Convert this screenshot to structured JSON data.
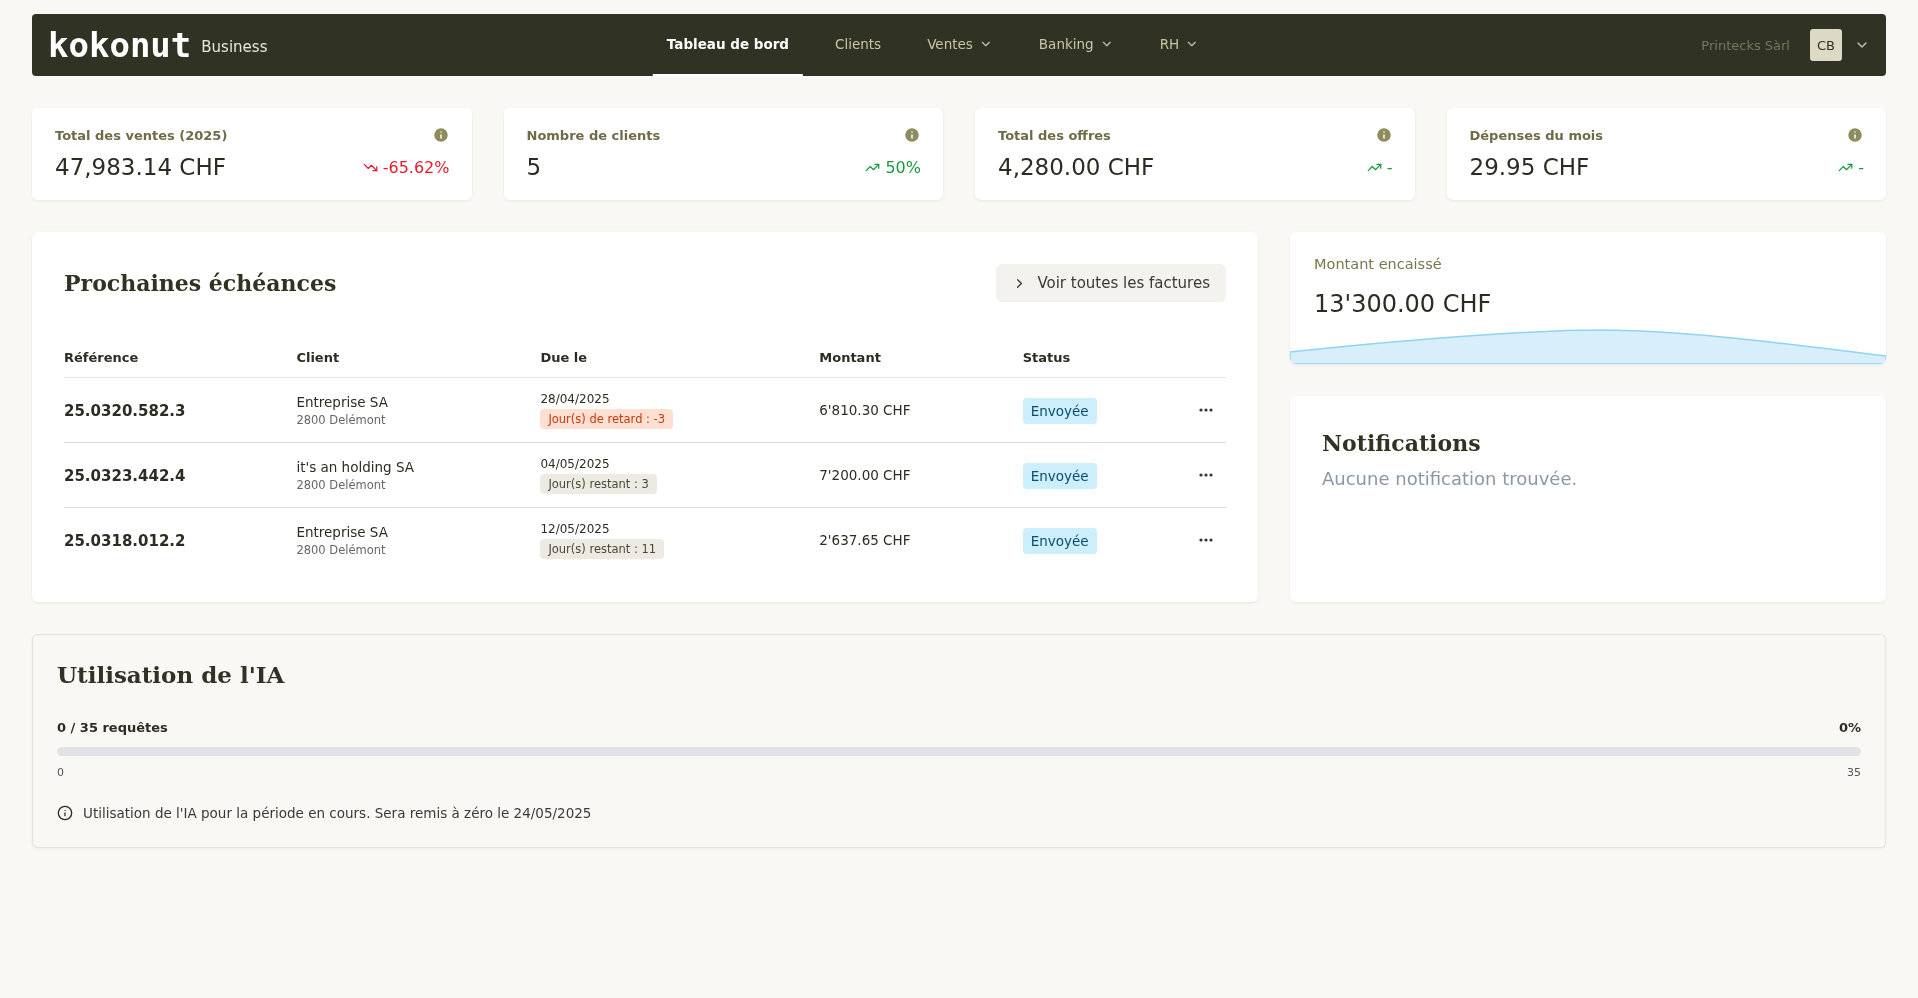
{
  "nav": {
    "logo": "kokonut",
    "logo_suffix": "Business",
    "items": [
      {
        "label": "Tableau de bord",
        "selected": true,
        "dropdown": false
      },
      {
        "label": "Clients",
        "selected": false,
        "dropdown": false
      },
      {
        "label": "Ventes",
        "selected": false,
        "dropdown": true
      },
      {
        "label": "Banking",
        "selected": false,
        "dropdown": true
      },
      {
        "label": "RH",
        "selected": false,
        "dropdown": true
      }
    ],
    "company": "Printecks Sàrl",
    "avatar": "CB"
  },
  "stats": [
    {
      "label": "Total des ventes (2025)",
      "value": "47,983.14 CHF",
      "trend": "-65.62%",
      "kind": "down"
    },
    {
      "label": "Nombre de clients",
      "value": "5",
      "trend": "50%",
      "kind": "up"
    },
    {
      "label": "Total des offres",
      "value": "4,280.00 CHF",
      "trend": "-",
      "kind": "up"
    },
    {
      "label": "Dépenses du mois",
      "value": "29.95 CHF",
      "trend": "-",
      "kind": "up"
    }
  ],
  "deadlines": {
    "title": "Prochaines échéances",
    "button": "Voir toutes les factures",
    "columns": [
      "Référence",
      "Client",
      "Due le",
      "Montant",
      "Status"
    ],
    "rows": [
      {
        "reference": "25.0320.582.3",
        "client": "Entreprise SA",
        "city": "2800 Delémont",
        "due": "28/04/2025",
        "days": "Jour(s) de retard : -3",
        "kind": "late",
        "amount": "6'810.30 CHF",
        "status": "Envoyée"
      },
      {
        "reference": "25.0323.442.4",
        "client": "it's an holding SA",
        "city": "2800 Delémont",
        "due": "04/05/2025",
        "days": "Jour(s) restant : 3",
        "kind": "remaining",
        "amount": "7'200.00 CHF",
        "status": "Envoyée"
      },
      {
        "reference": "25.0318.012.2",
        "client": "Entreprise SA",
        "city": "2800 Delémont",
        "due": "12/05/2025",
        "days": "Jour(s) restant : 11",
        "kind": "remaining",
        "amount": "2'637.65 CHF",
        "status": "Envoyée"
      }
    ]
  },
  "collected": {
    "label": "Montant encaissé",
    "value": "13'300.00 CHF"
  },
  "notifications": {
    "title": "Notifications",
    "empty": "Aucune notification trouvée."
  },
  "ai_usage": {
    "title": "Utilisation de l'IA",
    "requests": "0 / 35 requêtes",
    "percent": "0%",
    "level": 0,
    "min": "0",
    "max": "35",
    "note": "Utilisation de l'IA pour la période en cours. Sera remis à zéro le 24/05/2025"
  }
}
